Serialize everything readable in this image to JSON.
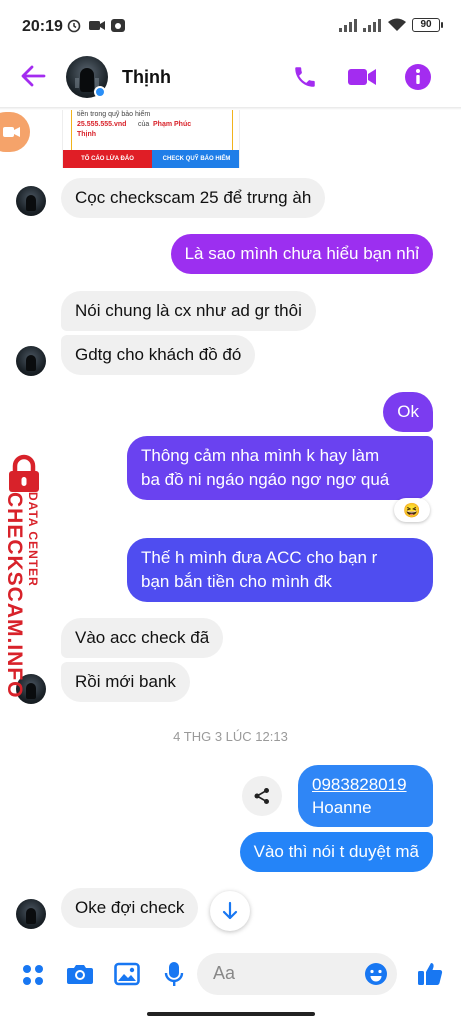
{
  "status_bar": {
    "time": "20:19",
    "battery": "90"
  },
  "header": {
    "contact_name": "Thịnh",
    "back_icon": "back-arrow-icon",
    "call_icon": "phone-icon",
    "video_icon": "video-camera-icon",
    "info_icon": "info-icon"
  },
  "shared_image": {
    "text_line1": "tiền trong quỹ bảo hiểm",
    "amount": "25.555.555.vnd",
    "text_of": "của",
    "payee": "Phạm Phúc",
    "payee2": "Thịnh",
    "button_left": "TỐ CÁO LỪA ĐẢO",
    "button_right": "CHECK QUỸ BẢO HIỂM"
  },
  "messages": [
    {
      "dir": "in",
      "text": "Cọc checkscam 25 để trưng àh"
    },
    {
      "dir": "out",
      "text": "Là sao mình chưa hiểu bạn nhỉ"
    },
    {
      "dir": "in",
      "text": "Nói chung là cx như ad gr thôi"
    },
    {
      "dir": "in",
      "text": "Gdtg cho khách đồ đó"
    },
    {
      "dir": "out",
      "text": "Ok"
    },
    {
      "dir": "out",
      "text_line1": "Thông cảm nha mình k hay làm",
      "text_line2": "ba đồ ni ngáo ngáo ngơ ngơ quá",
      "reaction": "😆"
    },
    {
      "dir": "out",
      "text_line1": "Thế h mình đưa ACC cho bạn r",
      "text_line2": "bạn bắn tiền cho mình đk"
    },
    {
      "dir": "in",
      "text": "Vào acc check đã"
    },
    {
      "dir": "in",
      "text": "Rồi mới bank"
    },
    {
      "dir": "out",
      "phone": "0983828019",
      "contact": "Hoanne"
    },
    {
      "dir": "out",
      "text": "Vào thì nói t duyệt mã"
    },
    {
      "dir": "in",
      "text": "Oke đợi check"
    }
  ],
  "timestamp": "4 THG 3 LÚC 12:13",
  "watermark": {
    "line1": "DATA CENTER",
    "line2": "CHECKSCAM.INFO"
  },
  "composer": {
    "placeholder": "Aa",
    "icons": [
      "apps-icon",
      "camera-icon",
      "gallery-icon",
      "microphone-icon",
      "emoji-icon",
      "like-icon"
    ]
  },
  "colors": {
    "accent": "#a32cf0",
    "bubble_in": "#f0f0f0",
    "blue": "#1877f2",
    "watermark_red": "#d8222a"
  }
}
